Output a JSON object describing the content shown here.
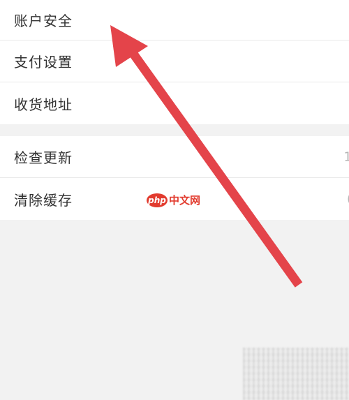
{
  "settings": {
    "group1": [
      {
        "label": "账户安全"
      },
      {
        "label": "支付设置"
      },
      {
        "label": "收货地址"
      }
    ],
    "group2": [
      {
        "label": "检查更新",
        "trail": "1"
      },
      {
        "label": "清除缓存",
        "trail": "("
      }
    ]
  },
  "watermark": {
    "badge": "php",
    "text": "中文网"
  },
  "colors": {
    "arrow": "#e4444a",
    "background": "#f2f2f2",
    "row_bg": "#ffffff"
  },
  "icons": {
    "annotation": "red-arrow-icon"
  }
}
